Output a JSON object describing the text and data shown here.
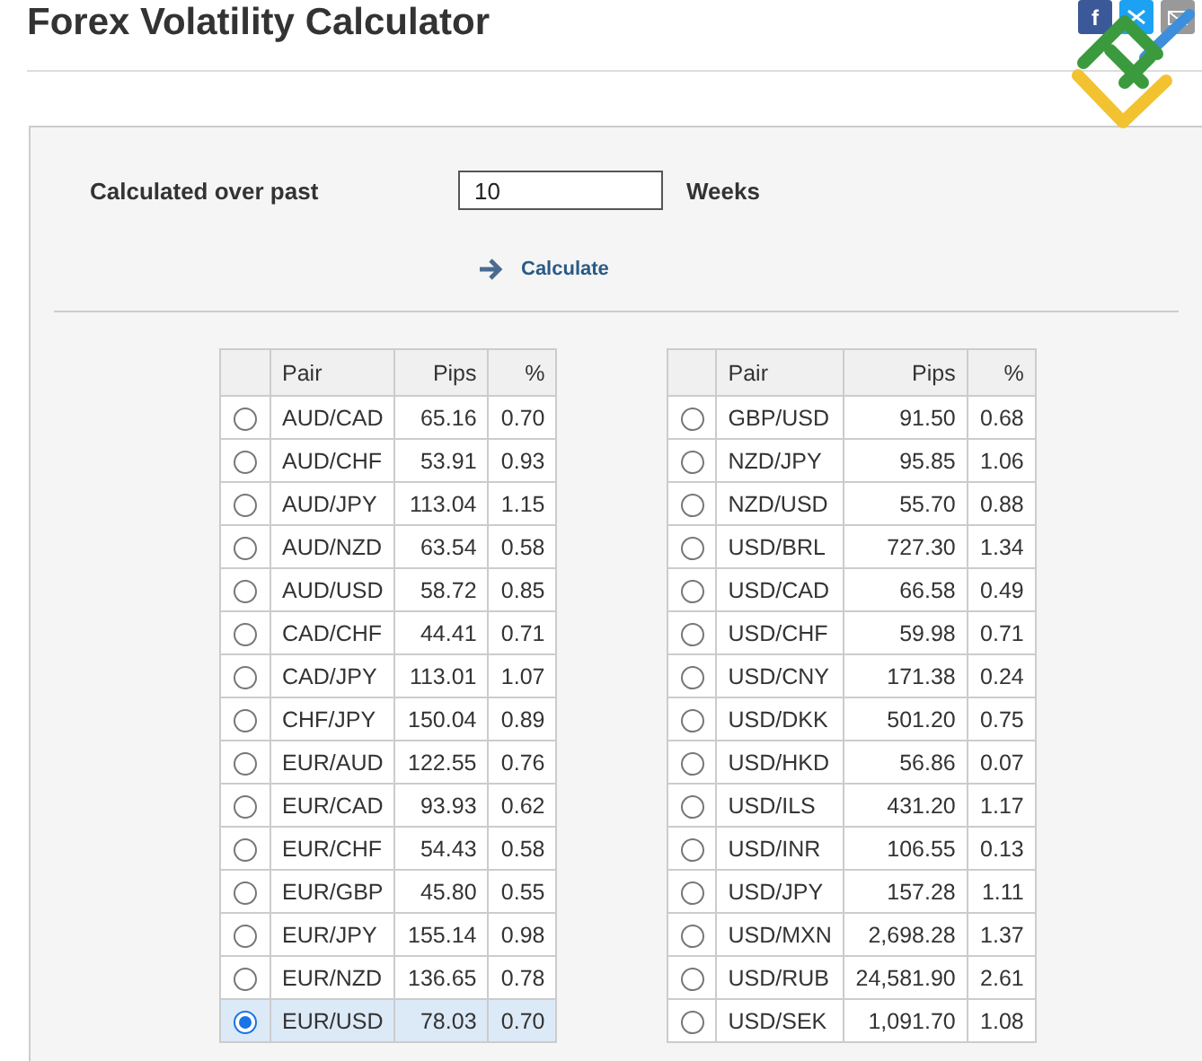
{
  "page": {
    "title": "Forex Volatility Calculator"
  },
  "share_buttons": [
    {
      "kind": "facebook",
      "label": "f"
    },
    {
      "kind": "twitter"
    },
    {
      "kind": "mail"
    }
  ],
  "form": {
    "label": "Calculated over past",
    "value": "10",
    "unit": "Weeks",
    "action": "Calculate"
  },
  "tables": [
    {
      "columns": [
        "Pair",
        "Pips",
        "%"
      ],
      "rows": [
        {
          "pair": "AUD/CAD",
          "pips": "65.16",
          "percent": "0.70",
          "selected": false
        },
        {
          "pair": "AUD/CHF",
          "pips": "53.91",
          "percent": "0.93",
          "selected": false
        },
        {
          "pair": "AUD/JPY",
          "pips": "113.04",
          "percent": "1.15",
          "selected": false
        },
        {
          "pair": "AUD/NZD",
          "pips": "63.54",
          "percent": "0.58",
          "selected": false
        },
        {
          "pair": "AUD/USD",
          "pips": "58.72",
          "percent": "0.85",
          "selected": false
        },
        {
          "pair": "CAD/CHF",
          "pips": "44.41",
          "percent": "0.71",
          "selected": false
        },
        {
          "pair": "CAD/JPY",
          "pips": "113.01",
          "percent": "1.07",
          "selected": false
        },
        {
          "pair": "CHF/JPY",
          "pips": "150.04",
          "percent": "0.89",
          "selected": false
        },
        {
          "pair": "EUR/AUD",
          "pips": "122.55",
          "percent": "0.76",
          "selected": false
        },
        {
          "pair": "EUR/CAD",
          "pips": "93.93",
          "percent": "0.62",
          "selected": false
        },
        {
          "pair": "EUR/CHF",
          "pips": "54.43",
          "percent": "0.58",
          "selected": false
        },
        {
          "pair": "EUR/GBP",
          "pips": "45.80",
          "percent": "0.55",
          "selected": false
        },
        {
          "pair": "EUR/JPY",
          "pips": "155.14",
          "percent": "0.98",
          "selected": false
        },
        {
          "pair": "EUR/NZD",
          "pips": "136.65",
          "percent": "0.78",
          "selected": false
        },
        {
          "pair": "EUR/USD",
          "pips": "78.03",
          "percent": "0.70",
          "selected": true
        }
      ]
    },
    {
      "columns": [
        "Pair",
        "Pips",
        "%"
      ],
      "rows": [
        {
          "pair": "GBP/USD",
          "pips": "91.50",
          "percent": "0.68",
          "selected": false
        },
        {
          "pair": "NZD/JPY",
          "pips": "95.85",
          "percent": "1.06",
          "selected": false
        },
        {
          "pair": "NZD/USD",
          "pips": "55.70",
          "percent": "0.88",
          "selected": false
        },
        {
          "pair": "USD/BRL",
          "pips": "727.30",
          "percent": "1.34",
          "selected": false
        },
        {
          "pair": "USD/CAD",
          "pips": "66.58",
          "percent": "0.49",
          "selected": false
        },
        {
          "pair": "USD/CHF",
          "pips": "59.98",
          "percent": "0.71",
          "selected": false
        },
        {
          "pair": "USD/CNY",
          "pips": "171.38",
          "percent": "0.24",
          "selected": false
        },
        {
          "pair": "USD/DKK",
          "pips": "501.20",
          "percent": "0.75",
          "selected": false
        },
        {
          "pair": "USD/HKD",
          "pips": "56.86",
          "percent": "0.07",
          "selected": false
        },
        {
          "pair": "USD/ILS",
          "pips": "431.20",
          "percent": "1.17",
          "selected": false
        },
        {
          "pair": "USD/INR",
          "pips": "106.55",
          "percent": "0.13",
          "selected": false
        },
        {
          "pair": "USD/JPY",
          "pips": "157.28",
          "percent": "1.11",
          "selected": false
        },
        {
          "pair": "USD/MXN",
          "pips": "2,698.28",
          "percent": "1.37",
          "selected": false
        },
        {
          "pair": "USD/RUB",
          "pips": "24,581.90",
          "percent": "2.61",
          "selected": false
        },
        {
          "pair": "USD/SEK",
          "pips": "1,091.70",
          "percent": "1.08",
          "selected": false
        }
      ]
    }
  ]
}
